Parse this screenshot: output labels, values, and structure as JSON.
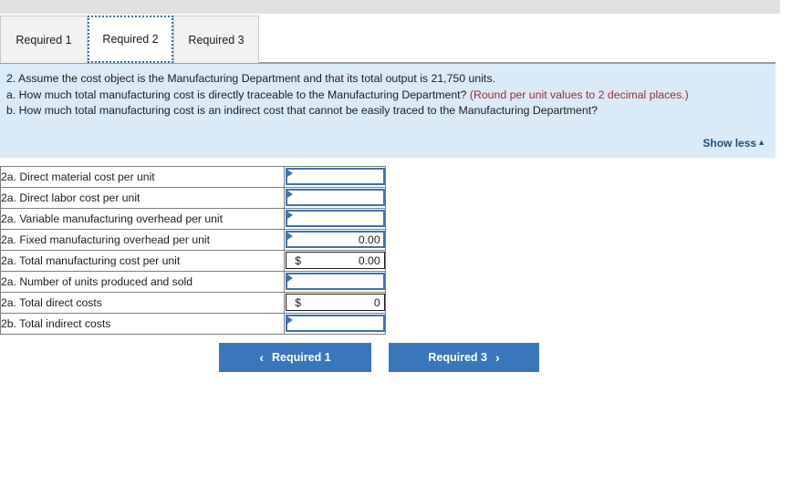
{
  "colors": {
    "banner_bg": "#daeaf7",
    "accent_blue": "#3a76ba",
    "input_border": "#3d72ae",
    "link_blue": "#1f4e79",
    "warning_red": "#9e2a35",
    "top_strip": "#e0e0e0",
    "tab_inactive": "#f2f2f2"
  },
  "tabs": [
    {
      "label": "Required 1",
      "active": false
    },
    {
      "label": "Required 2",
      "active": true
    },
    {
      "label": "Required 3",
      "active": false
    }
  ],
  "instructions": {
    "line1": "2. Assume the cost object is the Manufacturing Department and that its total output is 21,750 units.",
    "line2_main": "a. How much total manufacturing cost is directly traceable to the Manufacturing Department? ",
    "line2_red": "(Round per unit values to 2 decimal places.)",
    "line3": "b. How much total manufacturing cost is an indirect cost that cannot be easily traced to the Manufacturing Department?",
    "show_less_label": "Show less",
    "show_less_caret": "▲"
  },
  "table": {
    "rows": [
      {
        "label": "2a. Direct material cost per unit",
        "type": "input",
        "value": "",
        "currency": "",
        "marker": "input-marker-triangle-icon"
      },
      {
        "label": "2a. Direct labor cost per unit",
        "type": "input",
        "value": "",
        "currency": "",
        "marker": "input-marker-triangle-icon"
      },
      {
        "label": "2a. Variable manufacturing overhead per unit",
        "type": "input",
        "value": "",
        "currency": "",
        "marker": "input-marker-triangle-icon"
      },
      {
        "label": "2a. Fixed manufacturing overhead per unit",
        "type": "input",
        "value": "0.00",
        "currency": "",
        "marker": "input-marker-triangle-icon"
      },
      {
        "label": "2a. Total manufacturing cost per unit",
        "type": "readonly",
        "value": "0.00",
        "currency": "$",
        "marker": ""
      },
      {
        "label": "2a. Number of units produced and sold",
        "type": "input",
        "value": "",
        "currency": "",
        "marker": "input-marker-triangle-icon"
      },
      {
        "label": "2a. Total direct costs",
        "type": "readonly",
        "value": "0",
        "currency": "$",
        "marker": ""
      },
      {
        "label": "2b. Total indirect costs",
        "type": "input",
        "value": "",
        "currency": "",
        "marker": "input-marker-triangle-icon"
      }
    ]
  },
  "nav": {
    "prev_label": "Required 1",
    "prev_chevron": "‹",
    "next_label": "Required 3",
    "next_chevron": "›"
  }
}
